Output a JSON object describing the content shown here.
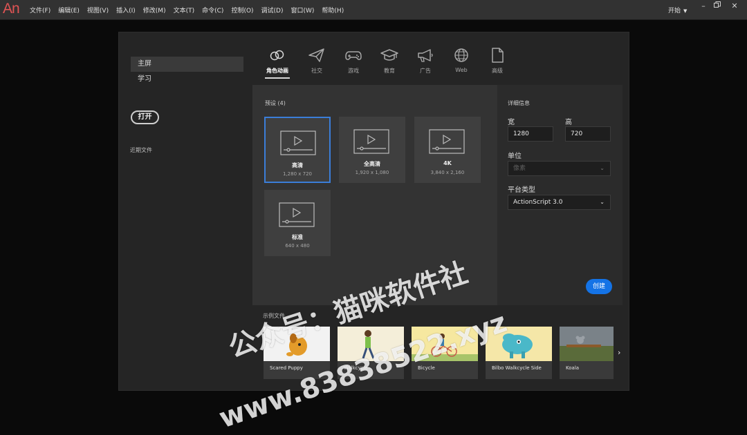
{
  "app": {
    "logo": "An"
  },
  "menubar": {
    "items": [
      "文件(F)",
      "编辑(E)",
      "视图(V)",
      "插入(I)",
      "修改(M)",
      "文本(T)",
      "命令(C)",
      "控制(O)",
      "调试(D)",
      "窗口(W)",
      "帮助(H)"
    ],
    "workspace": "开始",
    "window_controls": [
      "minimize-icon",
      "restore-icon",
      "close-icon"
    ]
  },
  "sidebar": {
    "items": [
      {
        "label": "主屏"
      },
      {
        "label": "学习"
      }
    ],
    "open_button": "打开",
    "recent_label": "近期文件"
  },
  "categories": [
    {
      "label": "角色动画",
      "icon": "character-animation-icon"
    },
    {
      "label": "社交",
      "icon": "paper-plane-icon"
    },
    {
      "label": "游戏",
      "icon": "gamepad-icon"
    },
    {
      "label": "教育",
      "icon": "graduation-cap-icon"
    },
    {
      "label": "广告",
      "icon": "megaphone-icon"
    },
    {
      "label": "Web",
      "icon": "globe-icon"
    },
    {
      "label": "高级",
      "icon": "document-icon"
    }
  ],
  "presets": {
    "title": "预设 (4)",
    "items": [
      {
        "label": "高清",
        "size": "1,280 x 720"
      },
      {
        "label": "全高清",
        "size": "1,920 x 1,080"
      },
      {
        "label": "4K",
        "size": "3,840 x 2,160"
      },
      {
        "label": "标准",
        "size": "640 x 480"
      }
    ]
  },
  "details": {
    "title": "详细信息",
    "width_label": "宽",
    "width_value": "1280",
    "height_label": "高",
    "height_value": "720",
    "unit_label": "单位",
    "unit_value": "像素",
    "platform_label": "平台类型",
    "platform_value": "ActionScript 3.0",
    "create_button": "创建"
  },
  "templates": {
    "label": "示例文件",
    "items": [
      {
        "name": "Scared Puppy"
      },
      {
        "name": "Walkcycle"
      },
      {
        "name": "Bicycle"
      },
      {
        "name": "Bilbo Walkcycle Side"
      },
      {
        "name": "Koala"
      }
    ]
  },
  "watermark": {
    "line1": "公众号：猫咪软件社",
    "line2": "www.83838522.xyz"
  },
  "colors": {
    "accent": "#1473e6",
    "selected_border": "#3b7ed9",
    "logo": "#e05454"
  }
}
